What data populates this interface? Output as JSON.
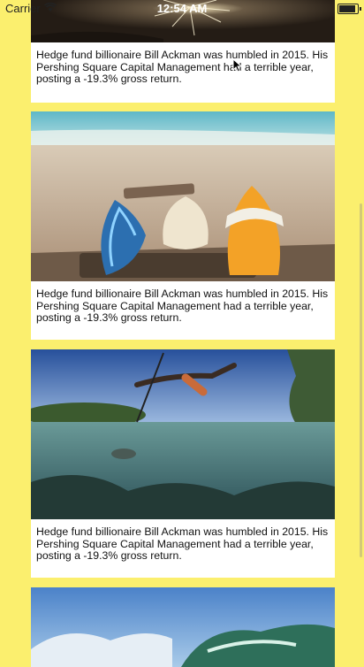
{
  "status": {
    "carrier": "Carrier",
    "time": "12:54 AM"
  },
  "cards": [
    {
      "caption": "Hedge fund billionaire Bill Ackman was humbled in 2015. His Pershing Square Capital Management had a terrible year, posting a -19.3% gross return.",
      "image": "sparkler-photo"
    },
    {
      "caption": "Hedge fund billionaire Bill Ackman was humbled in 2015. His Pershing Square Capital Management had a terrible year, posting a -19.3% gross return.",
      "image": "surfboards-on-beach-photo"
    },
    {
      "caption": "Hedge fund billionaire Bill Ackman was humbled in 2015. His Pershing Square Capital Management had a terrible year, posting a -19.3% gross return.",
      "image": "spearfisher-split-view-photo"
    },
    {
      "caption": "",
      "image": "underwater-wave-photo"
    }
  ],
  "colors": {
    "background": "#fbef6e",
    "card": "#ffffff",
    "text": "#111111"
  }
}
